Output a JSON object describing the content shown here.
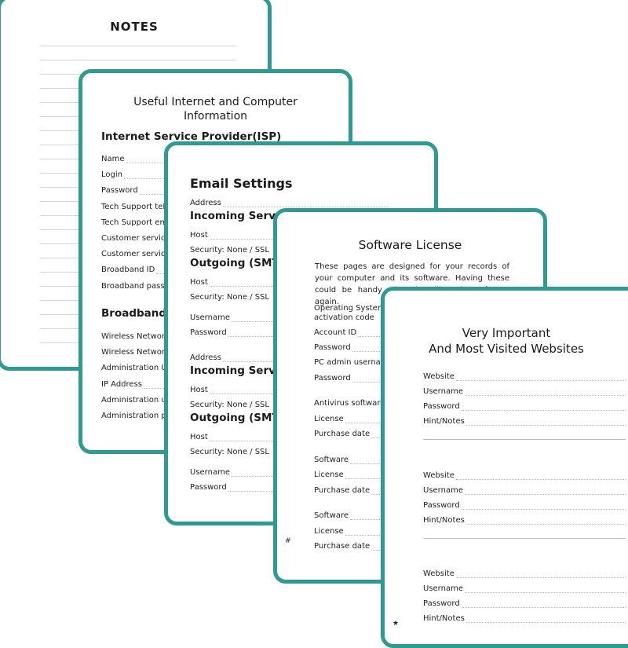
{
  "theme": {
    "border_color": "#2e9a92"
  },
  "notes_card": {
    "title": "NOTES"
  },
  "isp_card": {
    "title_line1": "Useful Internet and Computer",
    "title_line2": "Information",
    "section1_heading": "Internet Service Provider(ISP)",
    "section1_fields": [
      "Name",
      "Login",
      "Password",
      "Tech Support tel.",
      "Tech Support email",
      "Customer service",
      "Customer service",
      "Broadband ID",
      "Broadband password"
    ],
    "section2_heading": "Broadband Modem",
    "section2_fields": [
      "Wireless Network",
      "Wireless Network",
      "Administration URL",
      "IP Address",
      "Administration username",
      "Administration password"
    ]
  },
  "email_card": {
    "title": "Email Settings",
    "blocks": [
      {
        "address": "Address",
        "incoming_heading": "Incoming Server",
        "incoming_host": "Host",
        "incoming_security": "Security:   None   /   SSL",
        "outgoing_heading": "Outgoing (SMTP)",
        "outgoing_host": "Host",
        "outgoing_security": "Security:   None   /   SSL",
        "username": "Username",
        "password": "Password"
      },
      {
        "address": "Address",
        "incoming_heading": "Incoming Server",
        "incoming_host": "Host",
        "incoming_security": "Security:   None   /   SSL",
        "outgoing_heading": "Outgoing (SMTP)",
        "outgoing_host": "Host",
        "outgoing_security": "Security:   None   /   SSL",
        "username": "Username",
        "password": "Password"
      }
    ]
  },
  "software_card": {
    "title": "Software License",
    "intro": "These pages are designed for your records of your computer and its software. Having these could be handy when installing the software again.",
    "os_label_line1": "Operating System",
    "os_label_line2": "activation code",
    "fields": [
      "Account ID",
      "Password",
      "PC admin username",
      "Password"
    ],
    "group1": [
      "Antivirus software",
      "License",
      "Purchase date"
    ],
    "group2": [
      "Software",
      "License",
      "Purchase date"
    ],
    "group3": [
      "Software",
      "License",
      "Purchase date"
    ],
    "page_mark": "#"
  },
  "websites_card": {
    "title_line1": "Very Important",
    "title_line2": "And Most Visited Websites",
    "entries": [
      {
        "website": "Website",
        "username": "Username",
        "password": "Password",
        "hint": "Hint/Notes"
      },
      {
        "website": "Website",
        "username": "Username",
        "password": "Password",
        "hint": "Hint/Notes"
      },
      {
        "website": "Website",
        "username": "Username",
        "password": "Password",
        "hint": "Hint/Notes"
      }
    ],
    "page_mark": "★"
  }
}
